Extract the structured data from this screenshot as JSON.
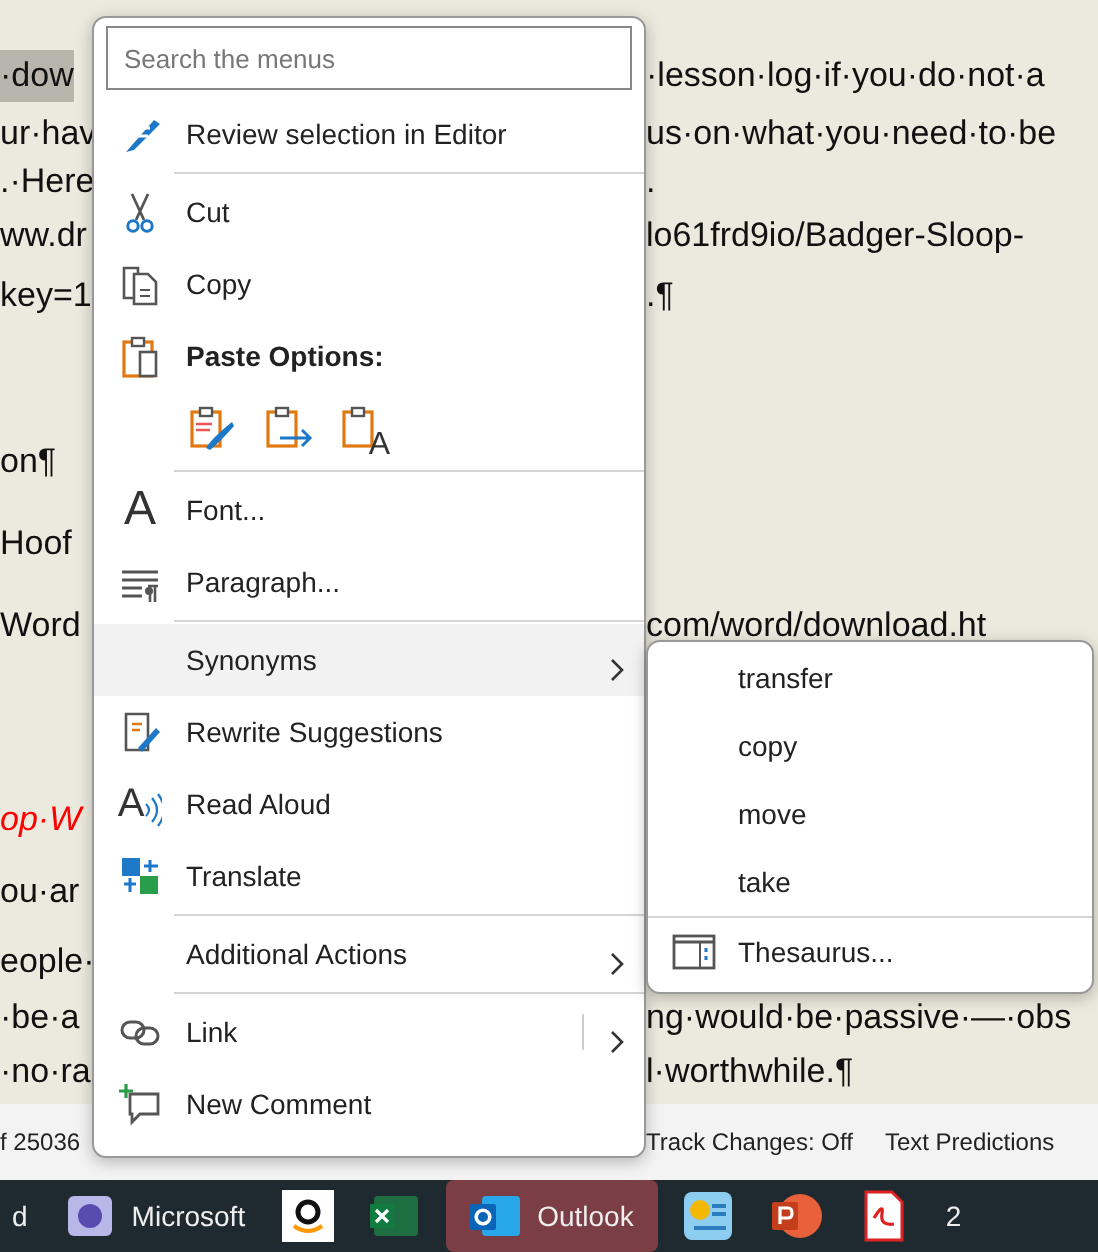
{
  "document": {
    "lines": [
      {
        "left": "·dow",
        "right": "·lesson·log·if·you·do·not·a",
        "selected": true,
        "emphasis": false
      },
      {
        "left": "ur·hav",
        "right": "us·on·what·you·need·to·be",
        "selected": false,
        "emphasis": false
      },
      {
        "left": ".·Here",
        "right": ".",
        "selected": false,
        "emphasis": false
      },
      {
        "left": "ww.dr",
        "right": "lo61frd9io/Badger-Sloop-",
        "selected": false,
        "emphasis": false
      },
      {
        "left": "key=1",
        "right": ".¶",
        "selected": false,
        "emphasis": false
      },
      {
        "left": "on¶",
        "selected": false,
        "emphasis": false
      },
      {
        "left": "Hoof",
        "selected": false,
        "emphasis": false
      },
      {
        "left": "Word",
        "right": "com/word/download.ht",
        "selected": false,
        "emphasis": false
      },
      {
        "left": "op·W",
        "selected": false,
        "emphasis": true
      },
      {
        "left": "ou·ar",
        "selected": false,
        "emphasis": false
      },
      {
        "left": "eople·",
        "selected": false,
        "emphasis": false
      },
      {
        "left": "·be·a",
        "right": "ng·would·be·passive·—·obs",
        "selected": false,
        "emphasis": false
      },
      {
        "left": "·no·ra",
        "right": "l·worthwhile.¶",
        "selected": false,
        "emphasis": false
      }
    ]
  },
  "context_menu": {
    "search": {
      "placeholder": "Search the menus"
    },
    "items": [
      {
        "kind": "command",
        "label": "Review selection in Editor",
        "selected": false
      },
      {
        "kind": "separator"
      },
      {
        "kind": "command",
        "label": "Cut",
        "selected": false
      },
      {
        "kind": "command",
        "label": "Copy",
        "selected": false
      },
      {
        "kind": "header",
        "label": "Paste Options:"
      },
      {
        "kind": "paste_options",
        "text_only_glyph": "A"
      },
      {
        "kind": "separator"
      },
      {
        "kind": "command",
        "label": "Font...",
        "icon_glyph": "A",
        "selected": false
      },
      {
        "kind": "command",
        "label": "Paragraph...",
        "selected": false
      },
      {
        "kind": "separator"
      },
      {
        "kind": "submenu",
        "label": "Synonyms",
        "selected": true
      },
      {
        "kind": "command",
        "label": "Rewrite Suggestions",
        "selected": false
      },
      {
        "kind": "command",
        "label": "Read Aloud",
        "icon_glyph": "A",
        "selected": false
      },
      {
        "kind": "command",
        "label": "Translate",
        "selected": false
      },
      {
        "kind": "separator"
      },
      {
        "kind": "submenu",
        "label": "Additional Actions",
        "selected": false
      },
      {
        "kind": "separator"
      },
      {
        "kind": "split",
        "label": "Link",
        "selected": false
      },
      {
        "kind": "command",
        "label": "New Comment",
        "selected": false
      }
    ]
  },
  "submenu": {
    "items": [
      {
        "kind": "command",
        "label": "transfer"
      },
      {
        "kind": "command",
        "label": "copy"
      },
      {
        "kind": "command",
        "label": "move"
      },
      {
        "kind": "command",
        "label": "take"
      },
      {
        "kind": "separator"
      },
      {
        "kind": "command",
        "label": "Thesaurus..."
      }
    ]
  },
  "status_bar": [
    "f 25036",
    "Track Changes: Off",
    "Text Predictions"
  ],
  "taskbar": [
    {
      "label": "d",
      "selected": false
    },
    {
      "label": "Microsoft",
      "selected": false
    },
    {
      "selected": false
    },
    {
      "selected": false
    },
    {
      "label": "Outlook",
      "selected": true
    },
    {
      "selected": false
    },
    {
      "selected": false
    },
    {
      "selected": false
    },
    {
      "label": "2",
      "selected": false
    }
  ]
}
